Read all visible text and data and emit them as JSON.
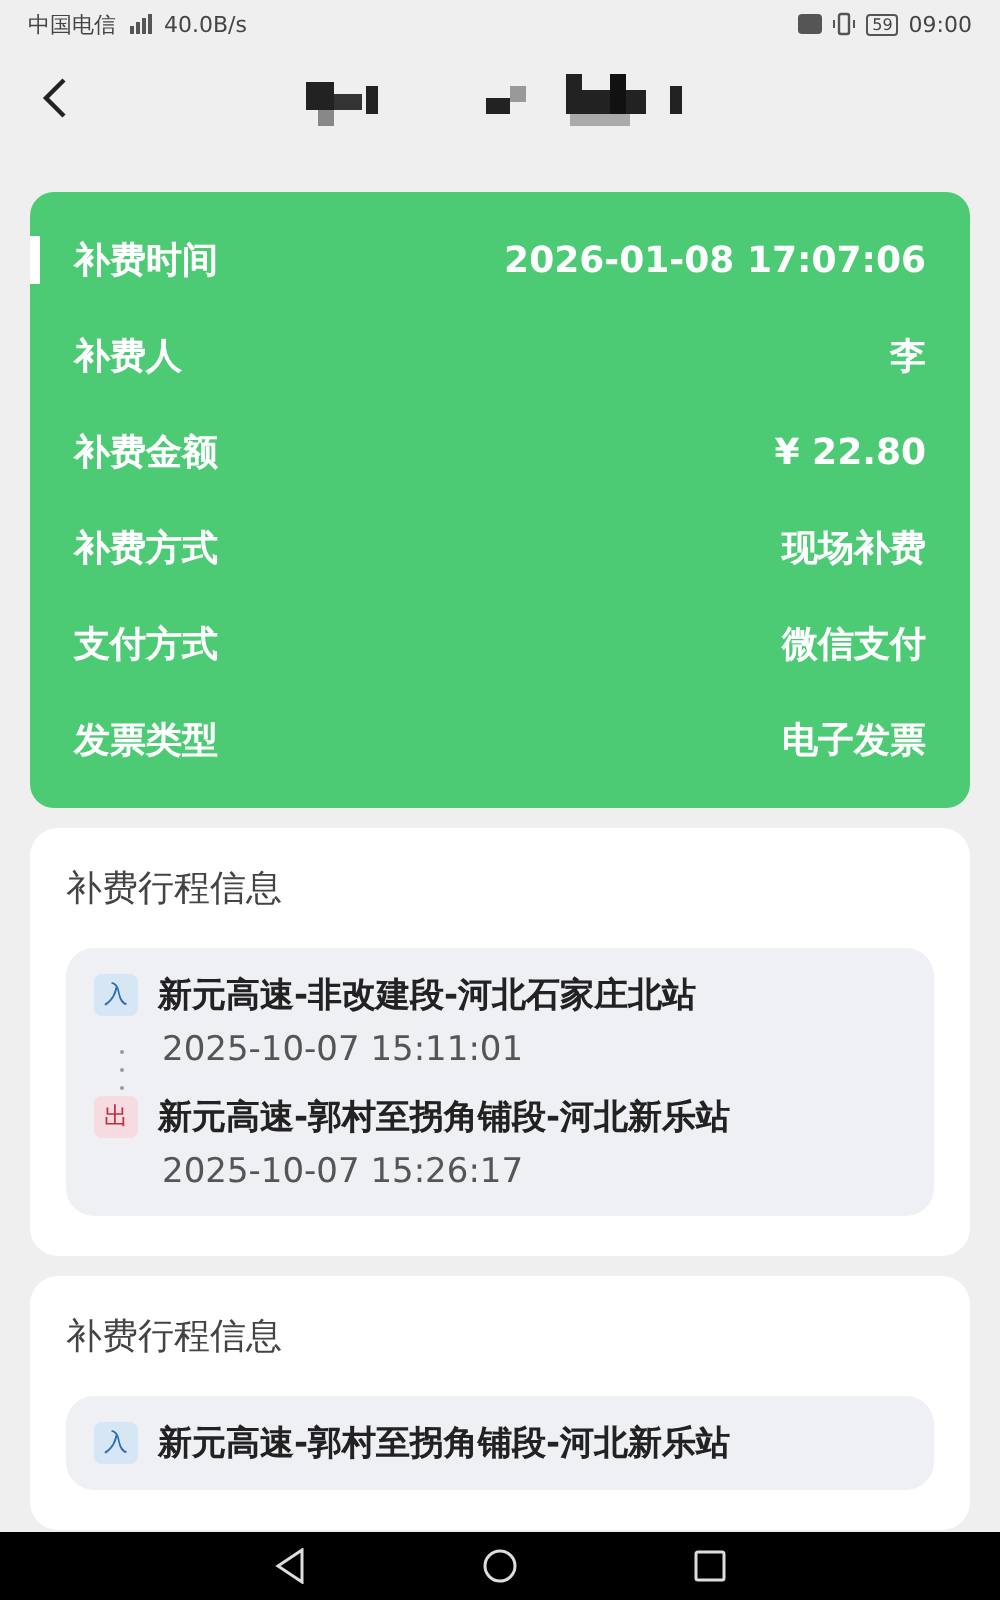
{
  "status_bar": {
    "carrier": "中国电信",
    "speed": "40.0B/s",
    "battery": "59",
    "time": "09:00"
  },
  "summary": {
    "rows": [
      {
        "label": "补费时间",
        "value": "2026-01-08 17:07:06",
        "highlighted": true
      },
      {
        "label": "补费人",
        "value": "李",
        "highlighted": false
      },
      {
        "label": "补费金额",
        "value": "¥ 22.80",
        "highlighted": false
      },
      {
        "label": "补费方式",
        "value": "现场补费",
        "highlighted": false
      },
      {
        "label": "支付方式",
        "value": "微信支付",
        "highlighted": false
      },
      {
        "label": "发票类型",
        "value": "电子发票",
        "highlighted": false
      }
    ]
  },
  "trips": [
    {
      "title": "补费行程信息",
      "stops": [
        {
          "kind": "entry",
          "badge": "入",
          "station": "新元高速-非改建段-河北石家庄北站",
          "time": "2025-10-07 15:11:01"
        },
        {
          "kind": "exit",
          "badge": "出",
          "station": "新元高速-郭村至拐角铺段-河北新乐站",
          "time": "2025-10-07 15:26:17"
        }
      ]
    },
    {
      "title": "补费行程信息",
      "stops": [
        {
          "kind": "entry",
          "badge": "入",
          "station": "新元高速-郭村至拐角铺段-河北新乐站"
        }
      ]
    }
  ]
}
